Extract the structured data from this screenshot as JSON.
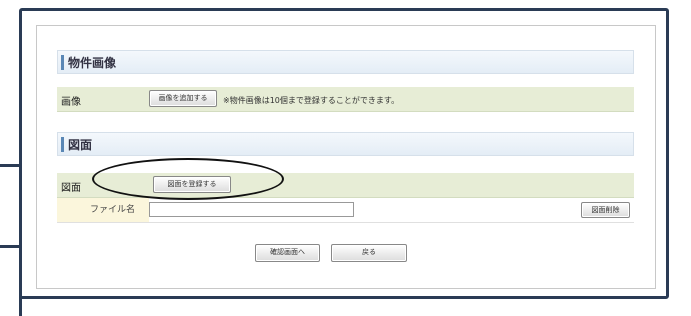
{
  "photo_section": {
    "header": "物件画像",
    "row_label": "画像",
    "add_button": "画像を追加する",
    "note": "※物件画像は10個まで登録することができます。"
  },
  "drawing_section": {
    "header": "図面",
    "row_label": "図面",
    "register_button": "図面を登録する",
    "file_label": "ファイル名",
    "file_value": "",
    "delete_button": "図面削除"
  },
  "footer": {
    "confirm_button": "確認画面へ",
    "back_button": "戻る"
  }
}
